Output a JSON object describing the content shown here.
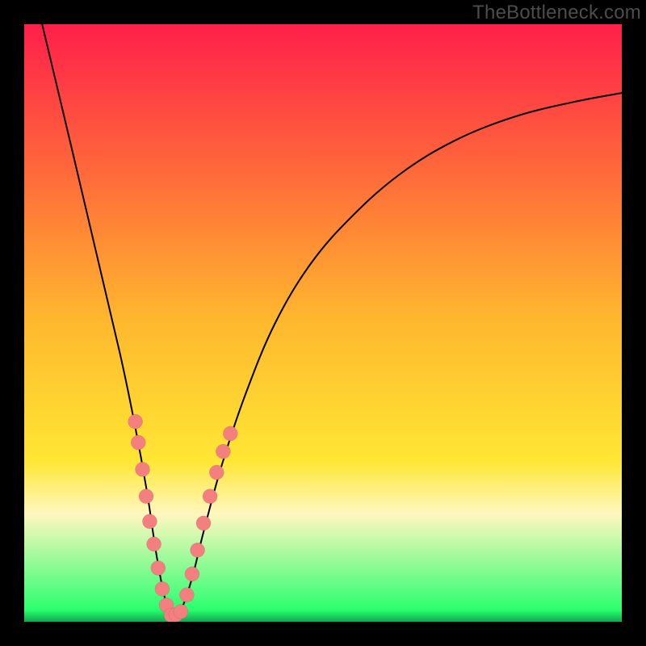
{
  "watermark": "TheBottleneck.com",
  "colors": {
    "top": "#ff1f4a",
    "upmid": "#ff6a3a",
    "mid": "#ffb92e",
    "lowmid": "#ffe634",
    "cream": "#fff7bf",
    "green": "#2bff6f",
    "green_dark": "#0fa84f",
    "bead": "#f47f7f"
  },
  "chart_data": {
    "type": "line",
    "title": "",
    "xlabel": "",
    "ylabel": "",
    "xlim": [
      0,
      100
    ],
    "ylim": [
      0,
      100
    ],
    "grid": false,
    "legend": false,
    "annotations": [
      "TheBottleneck.com"
    ],
    "series": [
      {
        "name": "bottleneck-curve",
        "x": [
          3,
          8,
          12,
          16,
          18.5,
          20.5,
          22,
          23.3,
          24.5,
          26,
          28,
          30,
          33,
          37,
          42,
          48,
          55,
          63,
          72,
          82,
          92,
          100
        ],
        "y": [
          100,
          79,
          62,
          45,
          33,
          22,
          12,
          5,
          1,
          1.5,
          7,
          15,
          26,
          38,
          50,
          60,
          68,
          75,
          80.5,
          84.5,
          87,
          88.5
        ]
      }
    ],
    "bead_clusters": [
      {
        "name": "left-arm-beads",
        "points": [
          {
            "x": 18.6,
            "y": 33.5
          },
          {
            "x": 19.1,
            "y": 30.0
          },
          {
            "x": 19.8,
            "y": 25.5
          },
          {
            "x": 20.4,
            "y": 21.0
          },
          {
            "x": 21.0,
            "y": 16.8
          },
          {
            "x": 21.7,
            "y": 13.0
          },
          {
            "x": 22.4,
            "y": 9.0
          },
          {
            "x": 23.1,
            "y": 5.5
          },
          {
            "x": 23.8,
            "y": 2.8
          }
        ]
      },
      {
        "name": "bottom-beads",
        "points": [
          {
            "x": 24.6,
            "y": 1.1
          },
          {
            "x": 25.4,
            "y": 1.2
          },
          {
            "x": 26.2,
            "y": 1.7
          }
        ]
      },
      {
        "name": "right-arm-beads",
        "points": [
          {
            "x": 27.2,
            "y": 4.5
          },
          {
            "x": 28.1,
            "y": 8.0
          },
          {
            "x": 29.0,
            "y": 12.0
          },
          {
            "x": 30.0,
            "y": 16.5
          },
          {
            "x": 31.1,
            "y": 21.0
          },
          {
            "x": 32.2,
            "y": 25.0
          },
          {
            "x": 33.3,
            "y": 28.5
          },
          {
            "x": 34.5,
            "y": 31.5
          }
        ]
      }
    ],
    "bead_radius_px": 9
  }
}
